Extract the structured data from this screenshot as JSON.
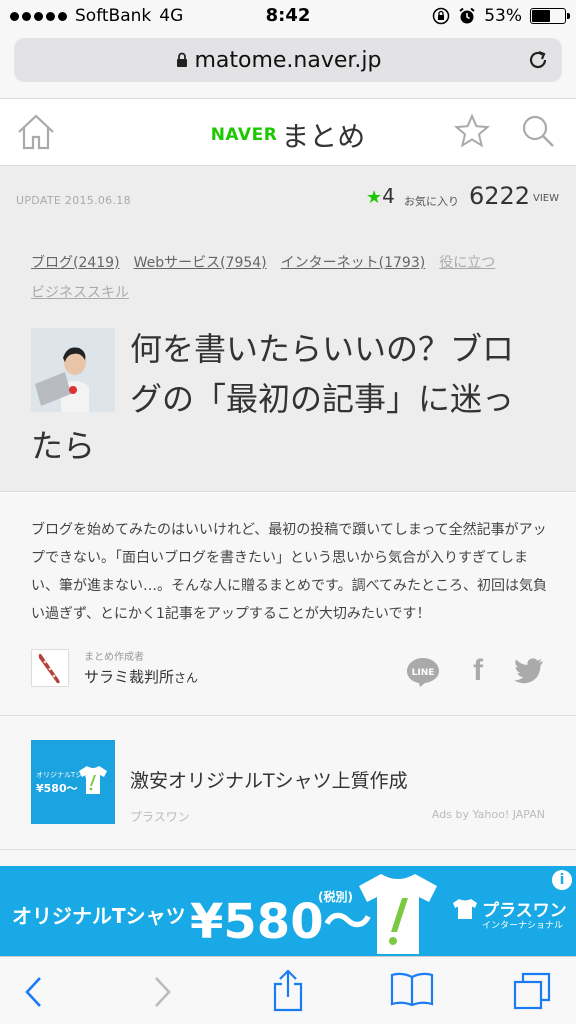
{
  "status_bar": {
    "carrier": "SoftBank",
    "network": "4G",
    "time": "8:42",
    "battery": "53%",
    "battery_level": 0.53
  },
  "browser": {
    "url": "matome.naver.jp"
  },
  "site_header": {
    "brand_naver": "NAVER",
    "brand_matome": "まとめ"
  },
  "meta": {
    "update": "UPDATE 2015.06.18",
    "favorites_count": "4",
    "favorites_label": "お気に入り",
    "views_count": "6222",
    "views_label": "VIEW"
  },
  "categories": [
    {
      "label": "ブログ(2419)"
    },
    {
      "label": "Webサービス(7954)"
    },
    {
      "label": "インターネット(1793)"
    },
    {
      "label": "役に立つ"
    },
    {
      "label": "ビジネススキル"
    }
  ],
  "article": {
    "title_line1": "何を書いたらいいの？ブロ",
    "title_line2": "グの「最初の記事」に迷っ",
    "title_line3": "たら",
    "description": "ブログを始めてみたのはいいけれど、最初の投稿で躓いてしまって全然記事がアップできない。「面白いブログを書きたい」という思いから気合が入りすぎてしまい、筆が進まない…。そんな人に贈るまとめです。調べてみたところ、初回は気負い過ぎず、とにかく1記事をアップすることが大切みたいです！",
    "author_label": "まとめ作成者",
    "author_name": "サラミ裁判所",
    "author_suffix": "さん"
  },
  "share": {
    "line": "LINE",
    "facebook": "f"
  },
  "ad": {
    "thumb_text1": "オリジナルTシャツ",
    "thumb_text2": "¥580〜",
    "title": "激安オリジナルTシャツ上質作成",
    "sponsor": "プラスワン",
    "ads_by": "Ads by Yahoo! JAPAN"
  },
  "banner": {
    "text1": "オリジナルTシャツ",
    "price": "¥580〜",
    "tax": "(税別)",
    "brand": "プラスワン",
    "brand_sub": "インターナショナル",
    "info": "i"
  }
}
